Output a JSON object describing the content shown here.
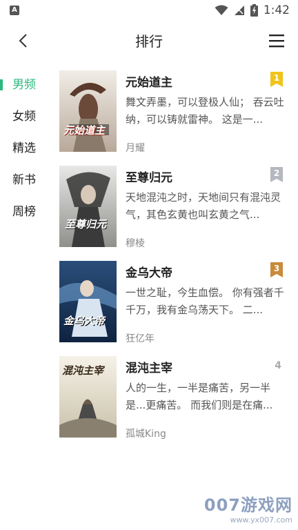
{
  "status": {
    "time": "1:42",
    "app_icon": "A"
  },
  "header": {
    "title": "排行"
  },
  "sidebar": {
    "items": [
      {
        "label": "男频",
        "active": true
      },
      {
        "label": "女频",
        "active": false
      },
      {
        "label": "精选",
        "active": false
      },
      {
        "label": "新书",
        "active": false
      },
      {
        "label": "周榜",
        "active": false
      }
    ]
  },
  "books": [
    {
      "title": "元始道主",
      "desc": "舞文弄墨，可以登极人仙； 吞云吐纳，可以铸就雷神。 这是一...",
      "author": "月耀",
      "rank": "1",
      "badge_color": "#f0c419",
      "cover_title": "元始道主"
    },
    {
      "title": "至尊归元",
      "desc": "天地混沌之时，天地间只有混沌灵气，其色玄黄也叫玄黄之气...",
      "author": "穆棱",
      "rank": "2",
      "badge_color": "#b5b8be",
      "cover_title": "至尊归元"
    },
    {
      "title": "金乌大帝",
      "desc": "一世之耻，今生血偿。 你有强者千千万，我有金乌荡天下。 二...",
      "author": "狂亿年",
      "rank": "3",
      "badge_color": "#c98a3a",
      "cover_title": "金乌大帝"
    },
    {
      "title": "混沌主宰",
      "desc": "人的一生，一半是痛苦，另一半是...更痛苦。 而我们则是在痛...",
      "author": "孤城King",
      "rank": "4",
      "badge_color": "",
      "cover_title": "混沌主宰"
    }
  ],
  "watermark": {
    "main": "007游戏网",
    "sub": "www.yx007.com"
  },
  "colors": {
    "accent": "#2db87e"
  }
}
